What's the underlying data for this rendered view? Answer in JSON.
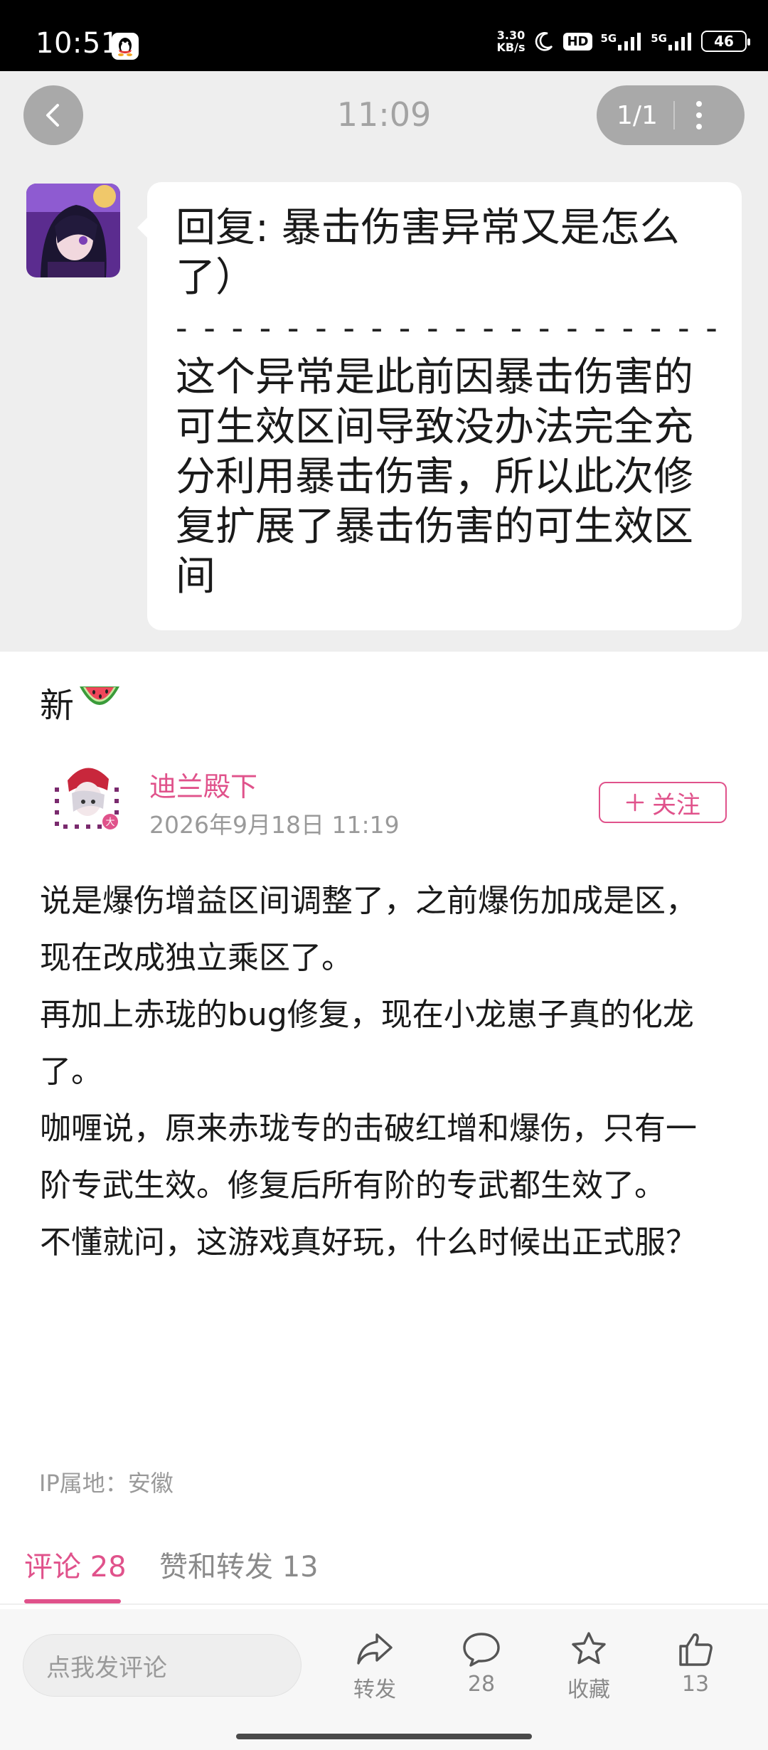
{
  "status_bar": {
    "time": "10:51",
    "net_speed_value": "3.30",
    "net_speed_unit": "KB/s",
    "hd_label": "HD",
    "signal_1": "5G",
    "signal_2": "5G",
    "battery": "46",
    "icons": [
      "qq-icon",
      "moon-icon",
      "signal-icon",
      "battery-icon"
    ]
  },
  "header": {
    "time": "11:09",
    "page_indicator": "1/1"
  },
  "quote": {
    "title": "回复: 暴击伤害异常又是怎么了）",
    "dashes": "- - - - - - - - - - - - - - - - - - - -",
    "body": "这个异常是此前因暴击伤害的可生效区间导致没办法完全充分利用暴击伤害，所以此次修复扩展了暴击伤害的可生效区间"
  },
  "post": {
    "new_text": "新",
    "emoji": "watermelon-icon",
    "author_name": "迪兰殿下",
    "date": "2026年9月18日 11:19",
    "follow_label": "关注",
    "paragraphs": [
      "说是爆伤增益区间调整了，之前爆伤加成是区，现在改成独立乘区了。",
      "再加上赤珑的bug修复，现在小龙崽子真的化龙了。",
      "咖喱说，原来赤珑专的击破红增和爆伤，只有一阶专武生效。修复后所有阶的专武都生效了。",
      "不懂就问，这游戏真好玩，什么时候出正式服？"
    ],
    "ip_location": "IP属地：安徽"
  },
  "tabs": [
    {
      "label": "评论 28",
      "active": true
    },
    {
      "label": "赞和转发 13",
      "active": false
    }
  ],
  "bottom_bar": {
    "comment_placeholder": "点我发评论",
    "share_label": "转发",
    "comment_count": "28",
    "favorite_label": "收藏",
    "like_count": "13"
  },
  "colors": {
    "accent": "#e0528b",
    "panel_bg": "#eeeeee"
  }
}
